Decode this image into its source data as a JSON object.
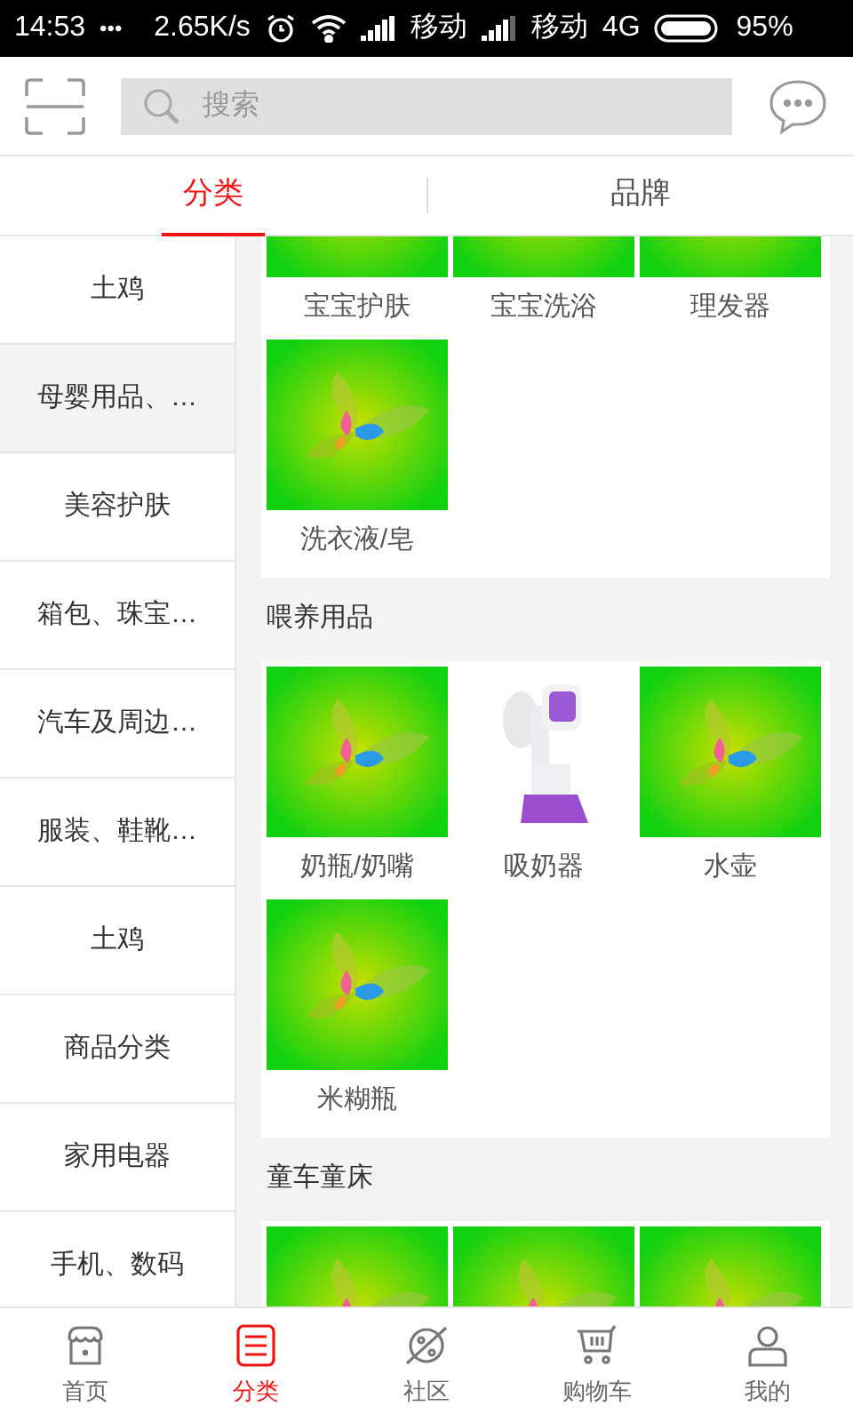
{
  "status_bar": {
    "time": "14:53",
    "dots": "•••",
    "speed": "2.65K/s",
    "carrier_1": "移动",
    "carrier_2": "移动",
    "network": "4G",
    "battery": "95%"
  },
  "search": {
    "placeholder": "搜索"
  },
  "tabs": [
    {
      "label": "分类",
      "selected": true
    },
    {
      "label": "品牌",
      "selected": false
    }
  ],
  "sidebar": {
    "items": [
      {
        "label": "土鸡",
        "selected": false
      },
      {
        "label": "母婴用品、…",
        "selected": true
      },
      {
        "label": "美容护肤",
        "selected": false
      },
      {
        "label": "箱包、珠宝…",
        "selected": false
      },
      {
        "label": "汽车及周边…",
        "selected": false
      },
      {
        "label": "服装、鞋靴…",
        "selected": false
      },
      {
        "label": "土鸡",
        "selected": false
      },
      {
        "label": "商品分类",
        "selected": false
      },
      {
        "label": "家用电器",
        "selected": false
      },
      {
        "label": "手机、数码",
        "selected": false
      }
    ]
  },
  "sections": [
    {
      "items": [
        {
          "label": "宝宝护肤",
          "kind": "placeholder"
        },
        {
          "label": "宝宝洗浴",
          "kind": "placeholder"
        },
        {
          "label": "理发器",
          "kind": "placeholder"
        },
        {
          "label": "洗衣液/皂",
          "kind": "placeholder"
        }
      ]
    },
    {
      "title": "喂养用品",
      "items": [
        {
          "label": "奶瓶/奶嘴",
          "kind": "placeholder"
        },
        {
          "label": "吸奶器",
          "kind": "product"
        },
        {
          "label": "水壶",
          "kind": "placeholder"
        },
        {
          "label": "米糊瓶",
          "kind": "placeholder"
        }
      ]
    },
    {
      "title": "童车童床",
      "items": [
        {
          "kind": "placeholder"
        },
        {
          "kind": "placeholder"
        },
        {
          "kind": "placeholder"
        }
      ]
    }
  ],
  "bottom_nav": [
    {
      "label": "首页",
      "kind": "home",
      "selected": false
    },
    {
      "label": "分类",
      "kind": "category",
      "selected": true
    },
    {
      "label": "社区",
      "kind": "community",
      "selected": false
    },
    {
      "label": "购物车",
      "kind": "cart",
      "selected": false
    },
    {
      "label": "我的",
      "kind": "me",
      "selected": false
    }
  ]
}
